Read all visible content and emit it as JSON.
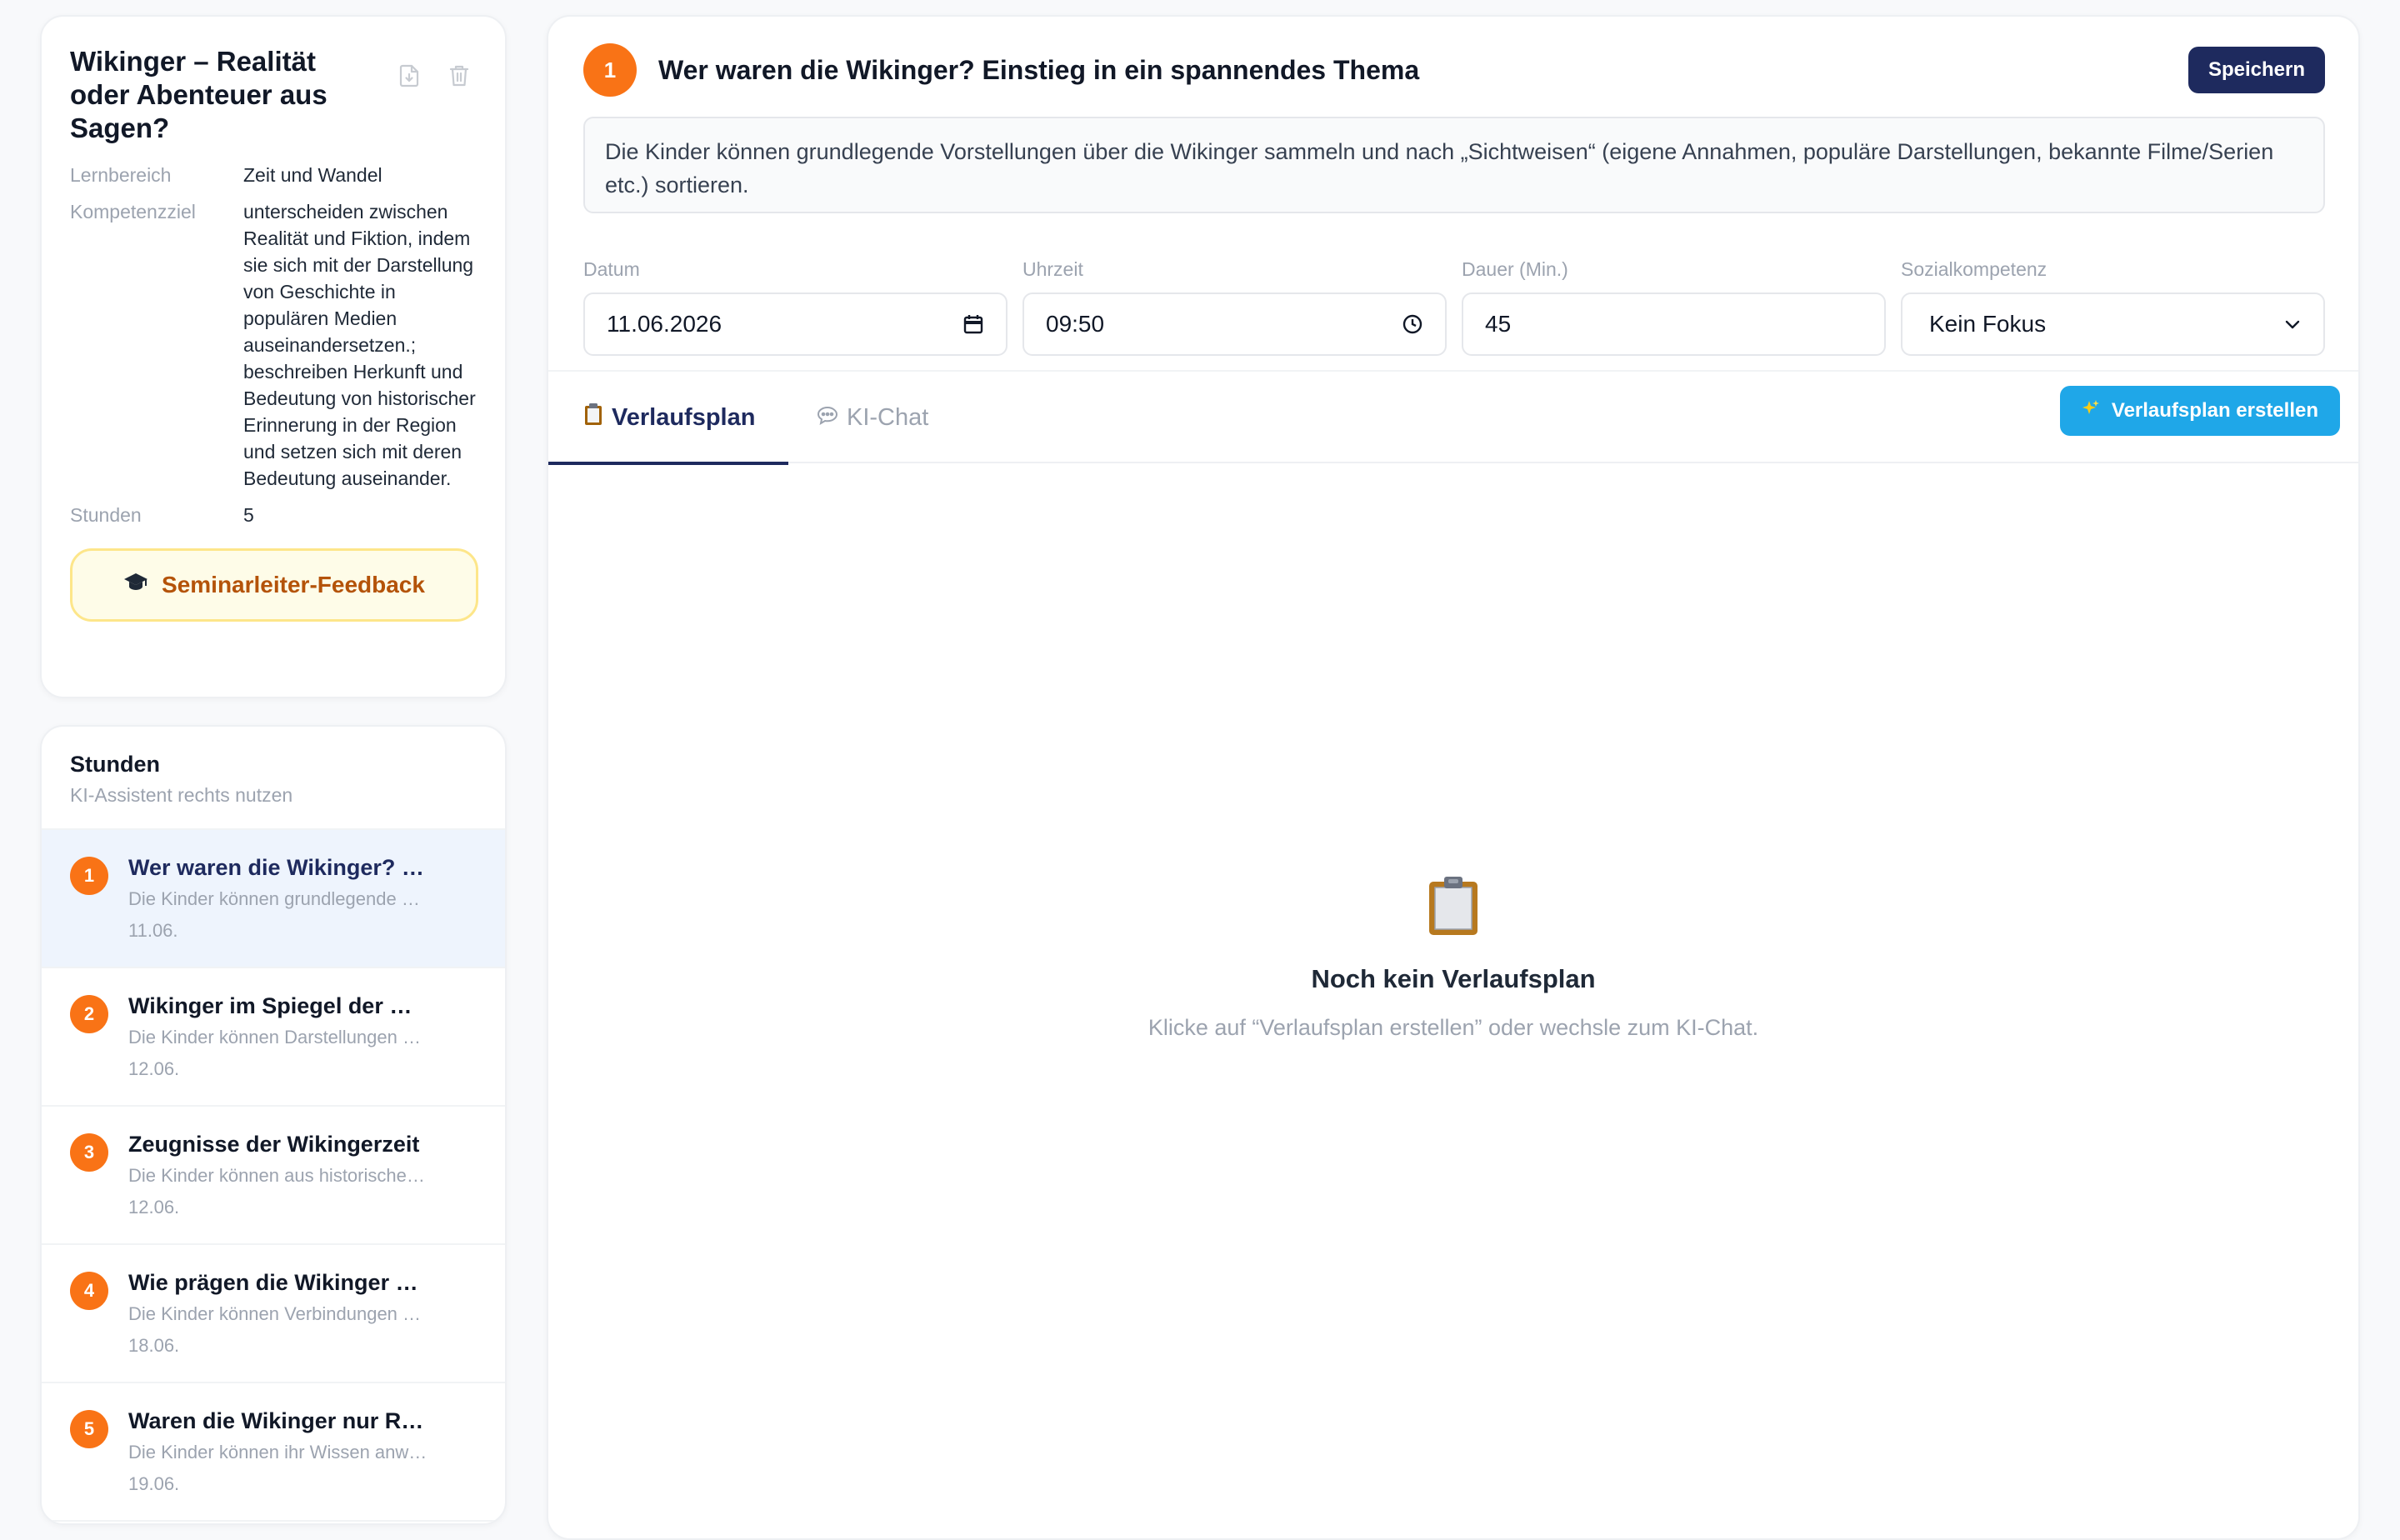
{
  "unit": {
    "title": "Wikinger – Realität oder Abenteuer aus Sagen?",
    "labels": {
      "lernbereich": "Lernbereich",
      "kompetenzziel": "Kompetenzziel",
      "stunden": "Stunden"
    },
    "lernbereich": "Zeit und Wandel",
    "kompetenzziel": "unterscheiden zwischen Realität und Fiktion, indem sie sich mit der Darstellung von Geschichte in populären Medien auseinandersetzen.; beschreiben Herkunft und Bedeutung von historischer Erinnerung in der Region und setzen sich mit deren Bedeutung auseinander.",
    "stunden": "5",
    "feedback_button": "Seminarleiter-Feedback"
  },
  "lessons_panel": {
    "title": "Stunden",
    "subtitle": "KI-Assistent rechts nutzen",
    "items": [
      {
        "num": "1",
        "title": "Wer waren die Wikinger? Einstieg in ein spannendes Thema",
        "desc": "Die Kinder können grundlegende Vorstellungen über die Wikinger sammeln",
        "date": "11.06."
      },
      {
        "num": "2",
        "title": "Wikinger im Spiegel der Medien",
        "desc": "Die Kinder können Darstellungen vergleichen",
        "date": "12.06."
      },
      {
        "num": "3",
        "title": "Zeugnisse der Wikingerzeit",
        "desc": "Die Kinder können aus historischen Quellen",
        "date": "12.06."
      },
      {
        "num": "4",
        "title": "Wie prägen die Wikinger unsere Region?",
        "desc": "Die Kinder können Verbindungen herstellen",
        "date": "18.06."
      },
      {
        "num": "5",
        "title": "Waren die Wikinger nur Räuber?",
        "desc": "Die Kinder können ihr Wissen anwenden",
        "date": "19.06."
      }
    ]
  },
  "lesson": {
    "number": "1",
    "title": "Wer waren die Wikinger? Einstieg in ein spannendes Thema",
    "save_label": "Speichern",
    "goal": "Die Kinder können grundlegende Vorstellungen über die Wikinger sammeln und nach „Sichtweisen“ (eigene Annahmen, populäre Darstellungen, bekannte Filme/Serien etc.) sortieren.",
    "fields": {
      "datum": {
        "label": "Datum",
        "value": "11.06.2026"
      },
      "uhrzeit": {
        "label": "Uhrzeit",
        "value": "09:50"
      },
      "dauer": {
        "label": "Dauer (Min.)",
        "value": "45"
      },
      "sozial": {
        "label": "Sozialkompetenz",
        "value": "Kein Fokus"
      }
    }
  },
  "tabs": {
    "plan": "Verlaufsplan",
    "chat": "KI-Chat",
    "create_button": "Verlaufsplan erstellen"
  },
  "empty_state": {
    "title": "Noch kein Verlaufsplan",
    "text": "Klicke auf “Verlaufsplan erstellen” oder wechsle zum KI-Chat."
  },
  "icons": {
    "download": "download-file-icon",
    "trash": "trash-icon",
    "grad_cap": "graduation-cap-icon",
    "calendar": "calendar-icon",
    "clock": "clock-icon",
    "chevron": "chevron-down-icon",
    "clipboard": "clipboard-icon",
    "chat": "speech-bubble-icon",
    "sparkle": "sparkles-icon"
  },
  "colors": {
    "accent_orange": "#f97316",
    "primary_navy": "#1e2a5e",
    "action_blue": "#1fa7e8",
    "feedback_bg": "#fefce8"
  }
}
